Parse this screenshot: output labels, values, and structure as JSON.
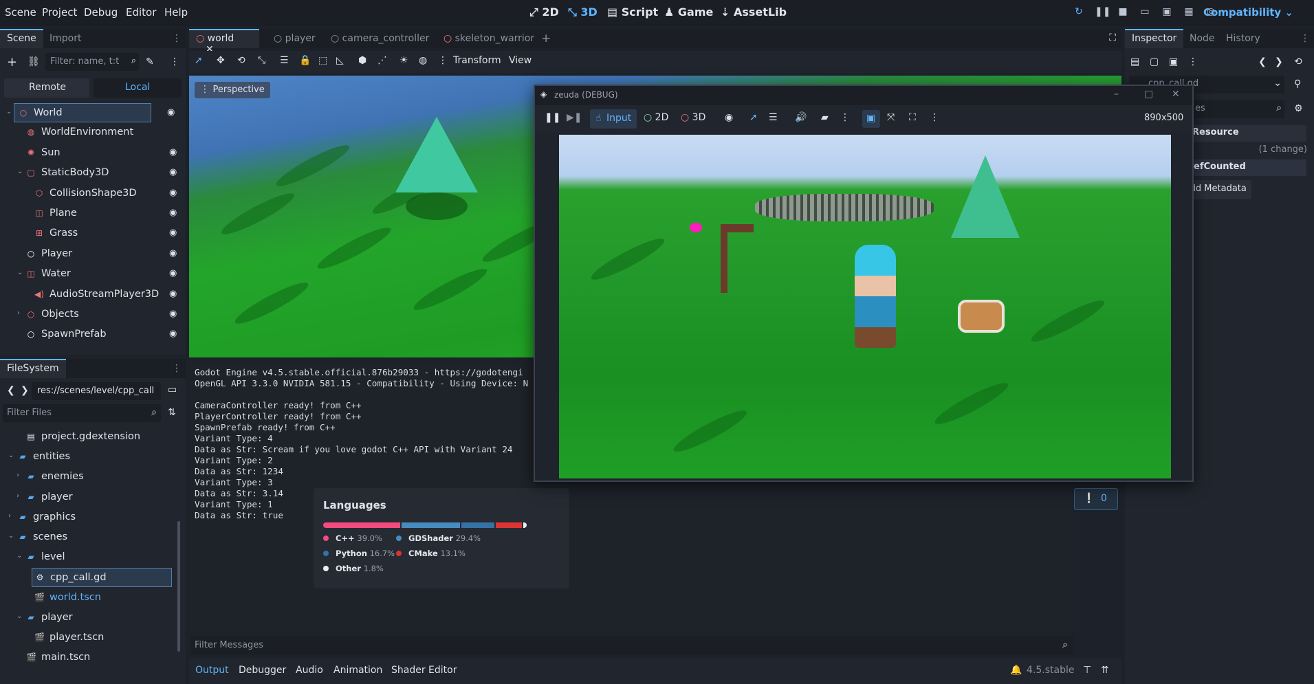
{
  "menubar": {
    "menus": [
      "Scene",
      "Project",
      "Debug",
      "Editor",
      "Help"
    ],
    "workspaces": [
      "2D",
      "3D",
      "Script",
      "Game",
      "AssetLib"
    ],
    "active_workspace": "3D",
    "renderer": "Compatibility"
  },
  "scene_dock": {
    "tabs": [
      "Scene",
      "Import"
    ],
    "filter_placeholder": "Filter: name, t:t",
    "remote_label": "Remote",
    "local_label": "Local",
    "nodes": [
      {
        "label": "World",
        "icon": "node3d-icon",
        "color": "#f0747a",
        "depth": 0,
        "expanded": true,
        "selected": true
      },
      {
        "label": "WorldEnvironment",
        "icon": "environment-icon",
        "color": "#f0747a",
        "depth": 1
      },
      {
        "label": "Sun",
        "icon": "sun-icon",
        "color": "#f0747a",
        "depth": 1
      },
      {
        "label": "StaticBody3D",
        "icon": "staticbody-icon",
        "color": "#f0747a",
        "depth": 1,
        "expanded": true
      },
      {
        "label": "CollisionShape3D",
        "icon": "collision-shape-icon",
        "color": "#f0747a",
        "depth": 2
      },
      {
        "label": "Plane",
        "icon": "mesh-icon",
        "color": "#f0747a",
        "depth": 2
      },
      {
        "label": "Grass",
        "icon": "multimesh-icon",
        "color": "#f0747a",
        "depth": 2
      },
      {
        "label": "Player",
        "icon": "node-icon",
        "color": "#ffffff",
        "depth": 1
      },
      {
        "label": "Water",
        "icon": "mesh-icon",
        "color": "#f0747a",
        "depth": 1,
        "expanded": true
      },
      {
        "label": "AudioStreamPlayer3D",
        "icon": "audio-icon",
        "color": "#f0747a",
        "depth": 2
      },
      {
        "label": "Objects",
        "icon": "node3d-icon",
        "color": "#f0747a",
        "depth": 1,
        "collapsed": true
      },
      {
        "label": "SpawnPrefab",
        "icon": "node-icon",
        "color": "#ffffff",
        "depth": 1
      }
    ]
  },
  "filesystem": {
    "tab": "FileSystem",
    "path": "res://scenes/level/cpp_call",
    "filter_placeholder": "Filter Files",
    "items": [
      {
        "label": "project.gdextension",
        "type": "file",
        "depth": 2
      },
      {
        "label": "entities",
        "type": "folder",
        "depth": 1,
        "expanded": true
      },
      {
        "label": "enemies",
        "type": "folder",
        "depth": 2
      },
      {
        "label": "player",
        "type": "folder",
        "depth": 2
      },
      {
        "label": "graphics",
        "type": "folder",
        "depth": 1
      },
      {
        "label": "scenes",
        "type": "folder",
        "depth": 1,
        "expanded": true
      },
      {
        "label": "level",
        "type": "folder",
        "depth": 2,
        "expanded": true
      },
      {
        "label": "cpp_call.gd",
        "type": "script",
        "depth": 3,
        "selected": true
      },
      {
        "label": "world.tscn",
        "type": "scene",
        "depth": 3,
        "highlight": true
      },
      {
        "label": "player",
        "type": "folder",
        "depth": 2,
        "expanded": true
      },
      {
        "label": "player.tscn",
        "type": "scene",
        "depth": 3
      },
      {
        "label": "main.tscn",
        "type": "scene",
        "depth": 2
      }
    ]
  },
  "editor_tabs": [
    "world",
    "player",
    "camera_controller",
    "skeleton_warrior"
  ],
  "toolbar": {
    "transform_label": "Transform",
    "view_label": "View"
  },
  "viewport": {
    "perspective_label": "Perspective"
  },
  "game_window": {
    "title": "zeuda (DEBUG)",
    "input_label": "Input",
    "mode_2d": "2D",
    "mode_3d": "3D",
    "resolution": "890x500"
  },
  "inspector": {
    "tabs": [
      "Inspector",
      "Node",
      "History"
    ],
    "resource_label": "Resource",
    "changes_label": "(1 change)",
    "refcounted_label": "RefCounted",
    "add_metadata_label": "Add Metadata",
    "file_label": "cpp_call.gd",
    "filter_fragment": "es",
    "counter_value": "0"
  },
  "output": {
    "lines": "Godot Engine v4.5.stable.official.876b29033 - https://godotengi\nOpenGL API 3.3.0 NVIDIA 581.15 - Compatibility - Using Device: N\n\nCameraController ready! from C++\nPlayerController ready! from C++\nSpawnPrefab ready! from C++\nVariant Type: 4\nData as Str: Scream if you love godot C++ API with Variant 24\nVariant Type: 2\nData as Str: 1234\nVariant Type: 3\nData as Str: 3.14\nVariant Type: 1\nData as Str: true",
    "filter_placeholder": "Filter Messages"
  },
  "languages": {
    "title": "Languages",
    "entries": [
      {
        "name": "C++",
        "percent": "39.0%",
        "value": 39.0,
        "color": "#f34b7d"
      },
      {
        "name": "GDShader",
        "percent": "29.4%",
        "value": 29.4,
        "color": "#478cbf"
      },
      {
        "name": "Python",
        "percent": "16.7%",
        "value": 16.7,
        "color": "#3572a5"
      },
      {
        "name": "CMake",
        "percent": "13.1%",
        "value": 13.1,
        "color": "#da3434"
      },
      {
        "name": "Other",
        "percent": "1.8%",
        "value": 1.8,
        "color": "#ededed"
      }
    ]
  },
  "bottom_panel": {
    "tabs": [
      "Output",
      "Debugger",
      "Audio",
      "Animation",
      "Shader Editor"
    ],
    "version": "4.5.stable"
  }
}
